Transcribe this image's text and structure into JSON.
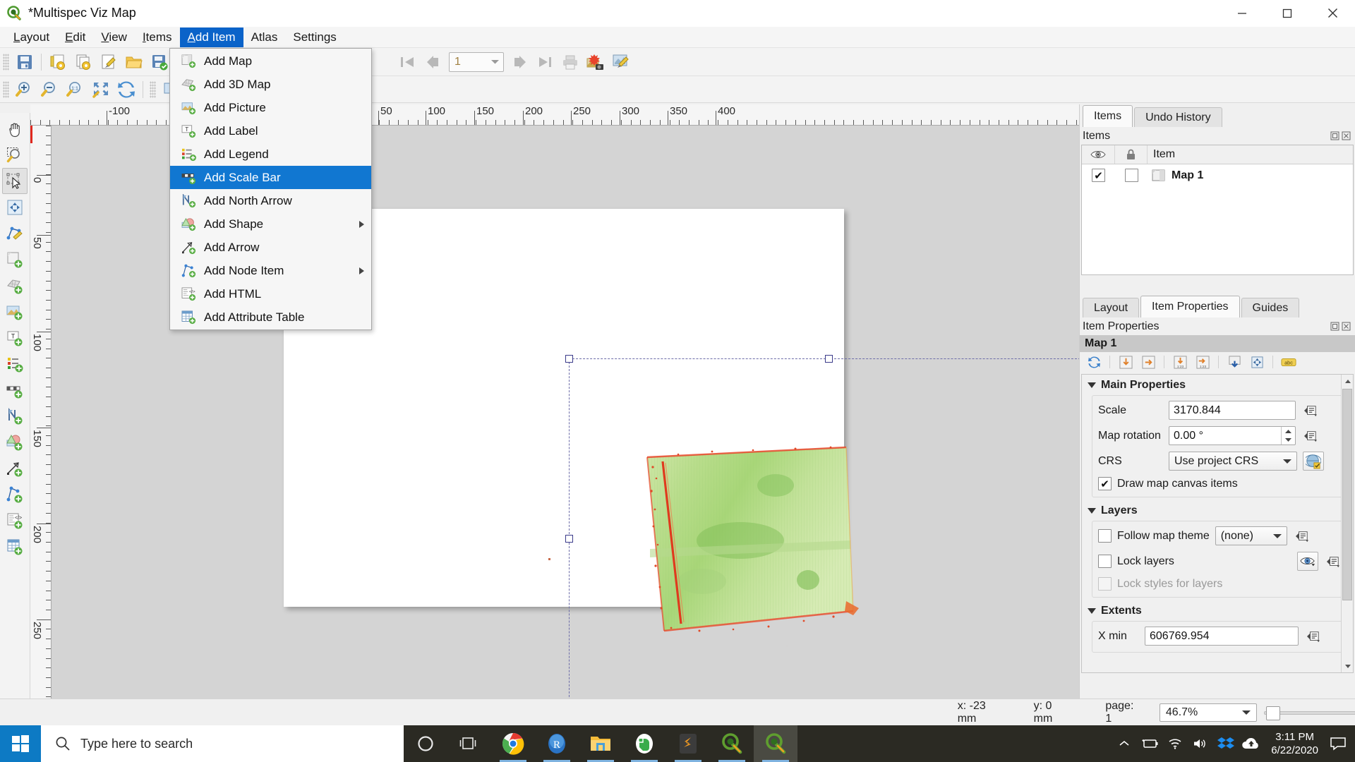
{
  "window": {
    "title": "*Multispec Viz Map",
    "app_icon": "qgis-icon",
    "minimize_label": "Minimize",
    "maximize_label": "Maximize",
    "close_label": "Close"
  },
  "menubar": {
    "items": [
      {
        "label": "Layout",
        "mnemonic": "L",
        "active": false
      },
      {
        "label": "Edit",
        "mnemonic": "E",
        "active": false
      },
      {
        "label": "View",
        "mnemonic": "V",
        "active": false
      },
      {
        "label": "Items",
        "mnemonic": "I",
        "active": false
      },
      {
        "label": "Add Item",
        "mnemonic": "A",
        "active": true
      },
      {
        "label": "Atlas",
        "mnemonic": "",
        "active": false
      },
      {
        "label": "Settings",
        "mnemonic": "",
        "active": false
      }
    ]
  },
  "add_item_menu": {
    "open": true,
    "items": [
      {
        "label": "Add Map",
        "icon": "add-map-icon",
        "highlighted": false,
        "submenu": false
      },
      {
        "label": "Add 3D Map",
        "icon": "add-3d-map-icon",
        "highlighted": false,
        "submenu": false
      },
      {
        "label": "Add Picture",
        "icon": "add-picture-icon",
        "highlighted": false,
        "submenu": false
      },
      {
        "label": "Add Label",
        "icon": "add-label-icon",
        "highlighted": false,
        "submenu": false
      },
      {
        "label": "Add Legend",
        "icon": "add-legend-icon",
        "highlighted": false,
        "submenu": false
      },
      {
        "label": "Add Scale Bar",
        "icon": "add-scale-bar-icon",
        "highlighted": true,
        "submenu": false
      },
      {
        "label": "Add North Arrow",
        "icon": "add-north-arrow-icon",
        "highlighted": false,
        "submenu": false
      },
      {
        "label": "Add Shape",
        "icon": "add-shape-icon",
        "highlighted": false,
        "submenu": true
      },
      {
        "label": "Add Arrow",
        "icon": "add-arrow-icon",
        "highlighted": false,
        "submenu": false
      },
      {
        "label": "Add Node Item",
        "icon": "add-node-item-icon",
        "highlighted": false,
        "submenu": true
      },
      {
        "label": "Add HTML",
        "icon": "add-html-icon",
        "highlighted": false,
        "submenu": false
      },
      {
        "label": "Add Attribute Table",
        "icon": "add-attribute-table-icon",
        "highlighted": false,
        "submenu": false
      }
    ]
  },
  "toolbar_main": {
    "buttons": [
      {
        "name": "save-project-icon",
        "tooltip": "Save Project"
      },
      {
        "name": "new-layout-icon",
        "tooltip": "New Layout"
      },
      {
        "name": "duplicate-layout-icon",
        "tooltip": "Duplicate Layout"
      },
      {
        "name": "layout-manager-icon",
        "tooltip": "Layout Manager"
      },
      {
        "name": "open-template-icon",
        "tooltip": "Add Items from Template"
      },
      {
        "name": "save-template-icon",
        "tooltip": "Save as Template"
      }
    ],
    "page_value": "1",
    "nav": [
      {
        "name": "first-page-icon",
        "tooltip": "First Feature"
      },
      {
        "name": "previous-page-icon",
        "tooltip": "Previous Feature"
      },
      {
        "name": "next-page-icon",
        "tooltip": "Next Feature"
      },
      {
        "name": "last-page-icon",
        "tooltip": "Last Feature"
      },
      {
        "name": "print-icon",
        "tooltip": "Print Layout"
      },
      {
        "name": "export-image-icon",
        "tooltip": "Export as Image"
      },
      {
        "name": "export-svg-icon",
        "tooltip": "Export as SVG"
      }
    ]
  },
  "toolbar_zoom": {
    "buttons": [
      {
        "name": "zoom-in-icon",
        "tooltip": "Zoom In"
      },
      {
        "name": "zoom-out-icon",
        "tooltip": "Zoom Out"
      },
      {
        "name": "zoom-actual-icon",
        "tooltip": "Zoom to 100%"
      },
      {
        "name": "zoom-full-icon",
        "tooltip": "Zoom Full"
      },
      {
        "name": "refresh-view-icon",
        "tooltip": "Refresh View"
      },
      {
        "name": "lock-items-icon",
        "tooltip": "Lock Selected Items"
      }
    ]
  },
  "left_toolbar": {
    "tools": [
      {
        "name": "pan-tool-icon",
        "tooltip": "Pan Layout",
        "selected": false
      },
      {
        "name": "zoom-tool-icon",
        "tooltip": "Zoom",
        "selected": false
      },
      {
        "name": "select-move-item-icon",
        "tooltip": "Select/Move Item",
        "selected": true
      },
      {
        "name": "move-item-content-icon",
        "tooltip": "Move Item Content",
        "selected": false
      },
      {
        "name": "edit-nodes-icon",
        "tooltip": "Edit Nodes Item",
        "selected": false
      },
      {
        "name": "add-map-tool-icon",
        "tooltip": "Add Map",
        "selected": false
      },
      {
        "name": "add-3d-map-tool-icon",
        "tooltip": "Add 3D Map",
        "selected": false
      },
      {
        "name": "add-picture-tool-icon",
        "tooltip": "Add Picture",
        "selected": false
      },
      {
        "name": "add-label-tool-icon",
        "tooltip": "Add Label",
        "selected": false
      },
      {
        "name": "add-legend-tool-icon",
        "tooltip": "Add Legend",
        "selected": false
      },
      {
        "name": "add-scalebar-tool-icon",
        "tooltip": "Add Scale Bar",
        "selected": false
      },
      {
        "name": "add-north-arrow-tool-icon",
        "tooltip": "Add North Arrow",
        "selected": false
      },
      {
        "name": "add-shape-tool-icon",
        "tooltip": "Add Shape",
        "selected": false
      },
      {
        "name": "add-arrow-tool-icon",
        "tooltip": "Add Arrow",
        "selected": false
      },
      {
        "name": "add-node-tool-icon",
        "tooltip": "Add Node Item",
        "selected": false
      },
      {
        "name": "add-html-tool-icon",
        "tooltip": "Add HTML",
        "selected": false
      },
      {
        "name": "add-table-tool-icon",
        "tooltip": "Add Attribute Table",
        "selected": false
      }
    ]
  },
  "rulers": {
    "horizontal_labels": [
      "-100",
      "50",
      "100",
      "150",
      "200",
      "250",
      "300",
      "350",
      "400"
    ],
    "vertical_labels": [
      "0",
      "50",
      "100",
      "150",
      "200",
      "250"
    ],
    "unit": "mm"
  },
  "panel": {
    "top_tabs": [
      {
        "label": "Items",
        "active": true
      },
      {
        "label": "Undo History",
        "active": false
      }
    ],
    "items_dock": {
      "title": "Items",
      "columns": [
        "visibility-eye",
        "lock",
        "Item"
      ],
      "item_header_label": "Item",
      "rows": [
        {
          "visible": true,
          "visible_mark": "✔",
          "locked": false,
          "name": "Map 1",
          "icon": "map-item-icon"
        }
      ],
      "float_btn": "undock-icon",
      "close_btn": "close-icon"
    },
    "bottom_tabs": [
      {
        "label": "Layout",
        "active": false
      },
      {
        "label": "Item Properties",
        "active": true
      },
      {
        "label": "Guides",
        "active": false
      }
    ],
    "item_properties": {
      "title": "Item Properties",
      "selected_item": "Map 1",
      "toolbar_icons": [
        "refresh-map-icon",
        "set-extent-from-canvas-icon",
        "set-canvas-from-extent-icon",
        "set-scale-from-canvas-icon",
        "set-canvas-from-scale-icon",
        "bookmark-down-icon",
        "view-extent-icon",
        "labels-icon"
      ],
      "sections": {
        "main_properties": {
          "title": "Main Properties",
          "scale_label": "Scale",
          "scale_value": "3170.844",
          "rotation_label": "Map rotation",
          "rotation_value": "0.00 °",
          "crs_label": "CRS",
          "crs_value": "Use project CRS",
          "draw_canvas_items_label": "Draw map canvas items",
          "draw_canvas_items_checked": true,
          "check_mark": "✔"
        },
        "layers": {
          "title": "Layers",
          "follow_map_theme_label": "Follow map theme",
          "follow_map_theme_checked": false,
          "map_theme_value": "(none)",
          "lock_layers_label": "Lock layers",
          "lock_layers_checked": false,
          "lock_styles_label": "Lock styles for layers",
          "lock_styles_checked": false,
          "lock_styles_disabled": true
        },
        "extents": {
          "title": "Extents",
          "x_min_label": "X min",
          "x_min_value": "606769.954"
        }
      }
    }
  },
  "statusbar": {
    "x_label": "x: -23 mm",
    "y_label": "y: 0 mm",
    "page_label": "page: 1",
    "zoom_value": "46.7%"
  },
  "taskbar": {
    "start_icon": "windows-start-icon",
    "search_placeholder": "Type here to search",
    "search_icon": "search-icon",
    "buttons": [
      {
        "name": "cortana-icon",
        "running": false
      },
      {
        "name": "task-view-icon",
        "running": false
      },
      {
        "name": "chrome-icon",
        "running": true
      },
      {
        "name": "r-studio-icon",
        "running": true
      },
      {
        "name": "file-explorer-icon",
        "running": true
      },
      {
        "name": "evernote-icon",
        "running": true
      },
      {
        "name": "sublime-text-icon",
        "running": true
      },
      {
        "name": "qgis-icon",
        "running": true
      },
      {
        "name": "qgis-layout-icon",
        "running": true,
        "active": true
      }
    ],
    "tray": [
      {
        "name": "show-hidden-icons-icon"
      },
      {
        "name": "battery-icon"
      },
      {
        "name": "wifi-icon"
      },
      {
        "name": "volume-icon"
      },
      {
        "name": "dropbox-icon"
      },
      {
        "name": "onedrive-icon"
      }
    ],
    "time": "3:11 PM",
    "date": "6/22/2020",
    "notification_icon": "notifications-icon"
  },
  "colors": {
    "accent": "#1177d1",
    "menu_active": "#0a63c9",
    "taskbar": "#2b2a23",
    "canvas_bg": "#d4d4d4",
    "panel_bg": "#f0f0f0"
  }
}
